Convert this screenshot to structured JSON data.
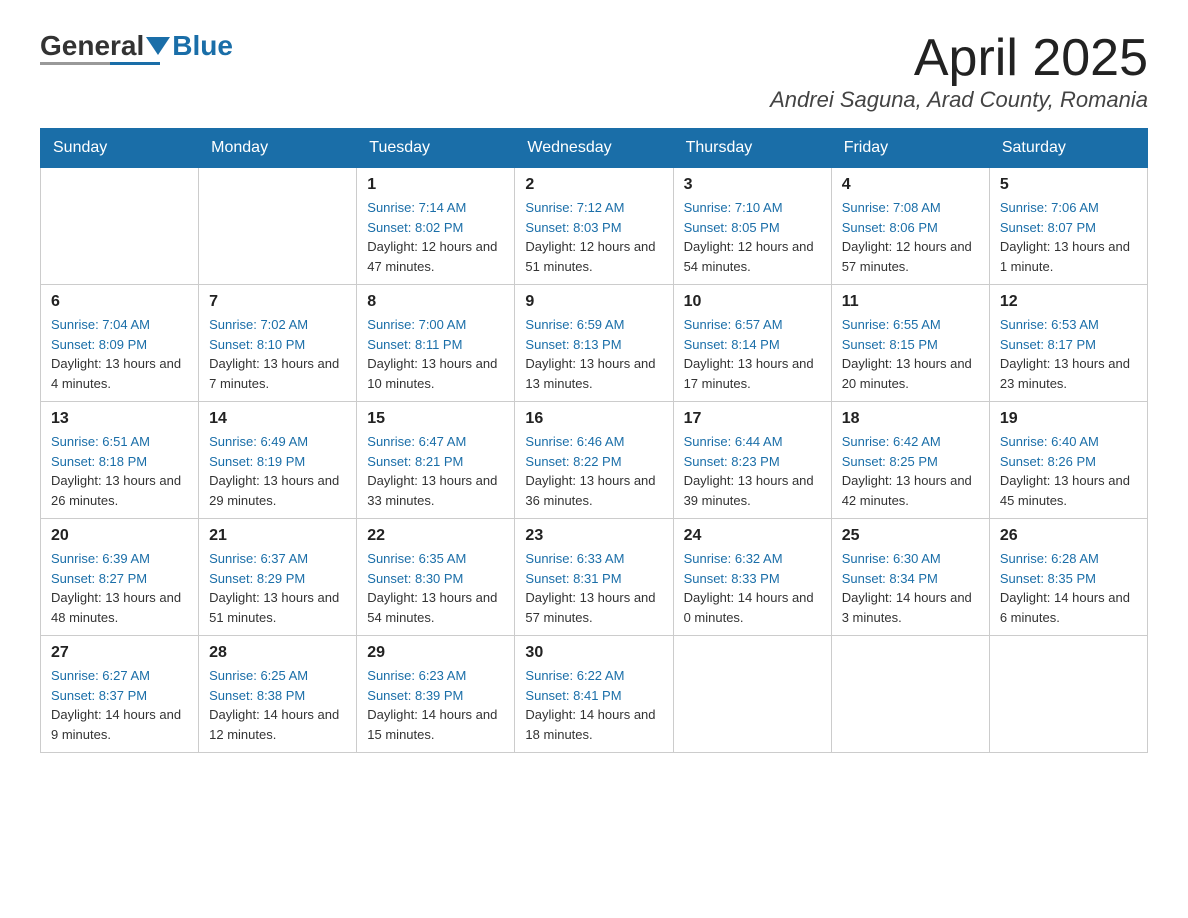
{
  "logo": {
    "general": "General",
    "blue": "Blue"
  },
  "header": {
    "month_title": "April 2025",
    "location": "Andrei Saguna, Arad County, Romania"
  },
  "weekdays": [
    "Sunday",
    "Monday",
    "Tuesday",
    "Wednesday",
    "Thursday",
    "Friday",
    "Saturday"
  ],
  "weeks": [
    [
      {
        "day": "",
        "sunrise": "",
        "sunset": "",
        "daylight": ""
      },
      {
        "day": "",
        "sunrise": "",
        "sunset": "",
        "daylight": ""
      },
      {
        "day": "1",
        "sunrise": "Sunrise: 7:14 AM",
        "sunset": "Sunset: 8:02 PM",
        "daylight": "Daylight: 12 hours and 47 minutes."
      },
      {
        "day": "2",
        "sunrise": "Sunrise: 7:12 AM",
        "sunset": "Sunset: 8:03 PM",
        "daylight": "Daylight: 12 hours and 51 minutes."
      },
      {
        "day": "3",
        "sunrise": "Sunrise: 7:10 AM",
        "sunset": "Sunset: 8:05 PM",
        "daylight": "Daylight: 12 hours and 54 minutes."
      },
      {
        "day": "4",
        "sunrise": "Sunrise: 7:08 AM",
        "sunset": "Sunset: 8:06 PM",
        "daylight": "Daylight: 12 hours and 57 minutes."
      },
      {
        "day": "5",
        "sunrise": "Sunrise: 7:06 AM",
        "sunset": "Sunset: 8:07 PM",
        "daylight": "Daylight: 13 hours and 1 minute."
      }
    ],
    [
      {
        "day": "6",
        "sunrise": "Sunrise: 7:04 AM",
        "sunset": "Sunset: 8:09 PM",
        "daylight": "Daylight: 13 hours and 4 minutes."
      },
      {
        "day": "7",
        "sunrise": "Sunrise: 7:02 AM",
        "sunset": "Sunset: 8:10 PM",
        "daylight": "Daylight: 13 hours and 7 minutes."
      },
      {
        "day": "8",
        "sunrise": "Sunrise: 7:00 AM",
        "sunset": "Sunset: 8:11 PM",
        "daylight": "Daylight: 13 hours and 10 minutes."
      },
      {
        "day": "9",
        "sunrise": "Sunrise: 6:59 AM",
        "sunset": "Sunset: 8:13 PM",
        "daylight": "Daylight: 13 hours and 13 minutes."
      },
      {
        "day": "10",
        "sunrise": "Sunrise: 6:57 AM",
        "sunset": "Sunset: 8:14 PM",
        "daylight": "Daylight: 13 hours and 17 minutes."
      },
      {
        "day": "11",
        "sunrise": "Sunrise: 6:55 AM",
        "sunset": "Sunset: 8:15 PM",
        "daylight": "Daylight: 13 hours and 20 minutes."
      },
      {
        "day": "12",
        "sunrise": "Sunrise: 6:53 AM",
        "sunset": "Sunset: 8:17 PM",
        "daylight": "Daylight: 13 hours and 23 minutes."
      }
    ],
    [
      {
        "day": "13",
        "sunrise": "Sunrise: 6:51 AM",
        "sunset": "Sunset: 8:18 PM",
        "daylight": "Daylight: 13 hours and 26 minutes."
      },
      {
        "day": "14",
        "sunrise": "Sunrise: 6:49 AM",
        "sunset": "Sunset: 8:19 PM",
        "daylight": "Daylight: 13 hours and 29 minutes."
      },
      {
        "day": "15",
        "sunrise": "Sunrise: 6:47 AM",
        "sunset": "Sunset: 8:21 PM",
        "daylight": "Daylight: 13 hours and 33 minutes."
      },
      {
        "day": "16",
        "sunrise": "Sunrise: 6:46 AM",
        "sunset": "Sunset: 8:22 PM",
        "daylight": "Daylight: 13 hours and 36 minutes."
      },
      {
        "day": "17",
        "sunrise": "Sunrise: 6:44 AM",
        "sunset": "Sunset: 8:23 PM",
        "daylight": "Daylight: 13 hours and 39 minutes."
      },
      {
        "day": "18",
        "sunrise": "Sunrise: 6:42 AM",
        "sunset": "Sunset: 8:25 PM",
        "daylight": "Daylight: 13 hours and 42 minutes."
      },
      {
        "day": "19",
        "sunrise": "Sunrise: 6:40 AM",
        "sunset": "Sunset: 8:26 PM",
        "daylight": "Daylight: 13 hours and 45 minutes."
      }
    ],
    [
      {
        "day": "20",
        "sunrise": "Sunrise: 6:39 AM",
        "sunset": "Sunset: 8:27 PM",
        "daylight": "Daylight: 13 hours and 48 minutes."
      },
      {
        "day": "21",
        "sunrise": "Sunrise: 6:37 AM",
        "sunset": "Sunset: 8:29 PM",
        "daylight": "Daylight: 13 hours and 51 minutes."
      },
      {
        "day": "22",
        "sunrise": "Sunrise: 6:35 AM",
        "sunset": "Sunset: 8:30 PM",
        "daylight": "Daylight: 13 hours and 54 minutes."
      },
      {
        "day": "23",
        "sunrise": "Sunrise: 6:33 AM",
        "sunset": "Sunset: 8:31 PM",
        "daylight": "Daylight: 13 hours and 57 minutes."
      },
      {
        "day": "24",
        "sunrise": "Sunrise: 6:32 AM",
        "sunset": "Sunset: 8:33 PM",
        "daylight": "Daylight: 14 hours and 0 minutes."
      },
      {
        "day": "25",
        "sunrise": "Sunrise: 6:30 AM",
        "sunset": "Sunset: 8:34 PM",
        "daylight": "Daylight: 14 hours and 3 minutes."
      },
      {
        "day": "26",
        "sunrise": "Sunrise: 6:28 AM",
        "sunset": "Sunset: 8:35 PM",
        "daylight": "Daylight: 14 hours and 6 minutes."
      }
    ],
    [
      {
        "day": "27",
        "sunrise": "Sunrise: 6:27 AM",
        "sunset": "Sunset: 8:37 PM",
        "daylight": "Daylight: 14 hours and 9 minutes."
      },
      {
        "day": "28",
        "sunrise": "Sunrise: 6:25 AM",
        "sunset": "Sunset: 8:38 PM",
        "daylight": "Daylight: 14 hours and 12 minutes."
      },
      {
        "day": "29",
        "sunrise": "Sunrise: 6:23 AM",
        "sunset": "Sunset: 8:39 PM",
        "daylight": "Daylight: 14 hours and 15 minutes."
      },
      {
        "day": "30",
        "sunrise": "Sunrise: 6:22 AM",
        "sunset": "Sunset: 8:41 PM",
        "daylight": "Daylight: 14 hours and 18 minutes."
      },
      {
        "day": "",
        "sunrise": "",
        "sunset": "",
        "daylight": ""
      },
      {
        "day": "",
        "sunrise": "",
        "sunset": "",
        "daylight": ""
      },
      {
        "day": "",
        "sunrise": "",
        "sunset": "",
        "daylight": ""
      }
    ]
  ]
}
